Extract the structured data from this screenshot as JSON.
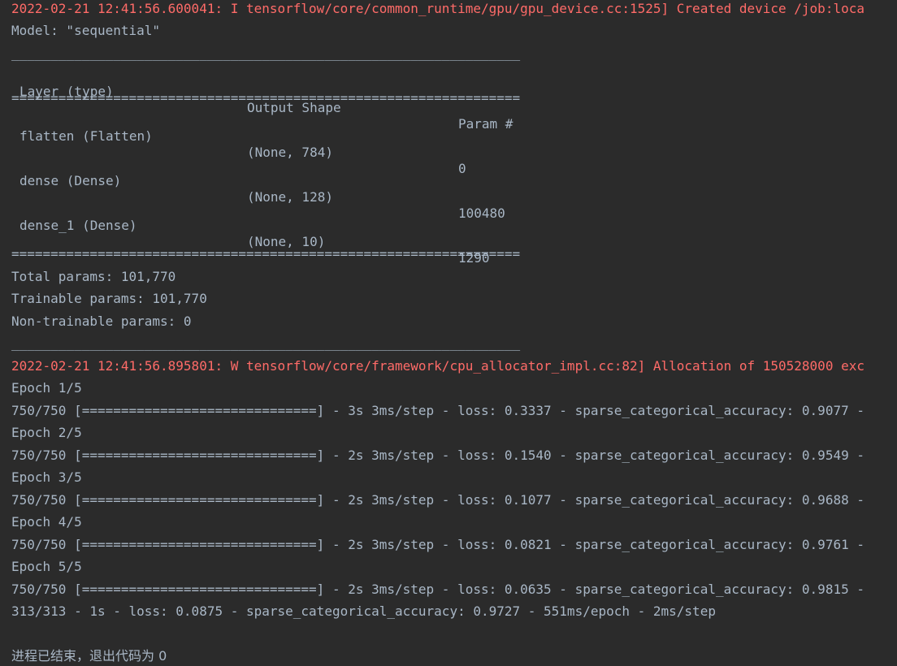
{
  "log": {
    "gpu_line": "2022-02-21 12:41:56.600041: I tensorflow/core/common_runtime/gpu/gpu_device.cc:1525] Created device /job:loca",
    "alloc_line": "2022-02-21 12:41:56.895801: W tensorflow/core/framework/cpu_allocator_impl.cc:82] Allocation of 150528000 exc",
    "colors": {
      "error": "#ff6b68",
      "text": "#a9b7c6",
      "background": "#2b2b2b"
    }
  },
  "summary": {
    "model_line": "Model: \"sequential\"",
    "dash_rule": "_________________________________________________________________",
    "eq_rule": "=================================================================",
    "headers": {
      "layer": "Layer (type)",
      "output": "Output Shape",
      "param": "Param #"
    },
    "layers": [
      {
        "name": "flatten (Flatten)",
        "shape": "(None, 784)",
        "params": "0"
      },
      {
        "name": "dense (Dense)",
        "shape": "(None, 128)",
        "params": "100480"
      },
      {
        "name": "dense_1 (Dense)",
        "shape": "(None, 10)",
        "params": "1290"
      }
    ],
    "total": "Total params: 101,770",
    "trainable": "Trainable params: 101,770",
    "non_trainable": "Non-trainable params: 0"
  },
  "training": {
    "epochs": [
      {
        "label": "Epoch 1/5",
        "progress": "750/750 [==============================] - 3s 3ms/step - loss: 0.3337 - sparse_categorical_accuracy: 0.9077 -"
      },
      {
        "label": "Epoch 2/5",
        "progress": "750/750 [==============================] - 2s 3ms/step - loss: 0.1540 - sparse_categorical_accuracy: 0.9549 -"
      },
      {
        "label": "Epoch 3/5",
        "progress": "750/750 [==============================] - 2s 3ms/step - loss: 0.1077 - sparse_categorical_accuracy: 0.9688 -"
      },
      {
        "label": "Epoch 4/5",
        "progress": "750/750 [==============================] - 2s 3ms/step - loss: 0.0821 - sparse_categorical_accuracy: 0.9761 -"
      },
      {
        "label": "Epoch 5/5",
        "progress": "750/750 [==============================] - 2s 3ms/step - loss: 0.0635 - sparse_categorical_accuracy: 0.9815 -"
      }
    ],
    "eval": "313/313 - 1s - loss: 0.0875 - sparse_categorical_accuracy: 0.9727 - 551ms/epoch - 2ms/step"
  },
  "exit": {
    "message": "进程已结束，退出代码为 0"
  }
}
